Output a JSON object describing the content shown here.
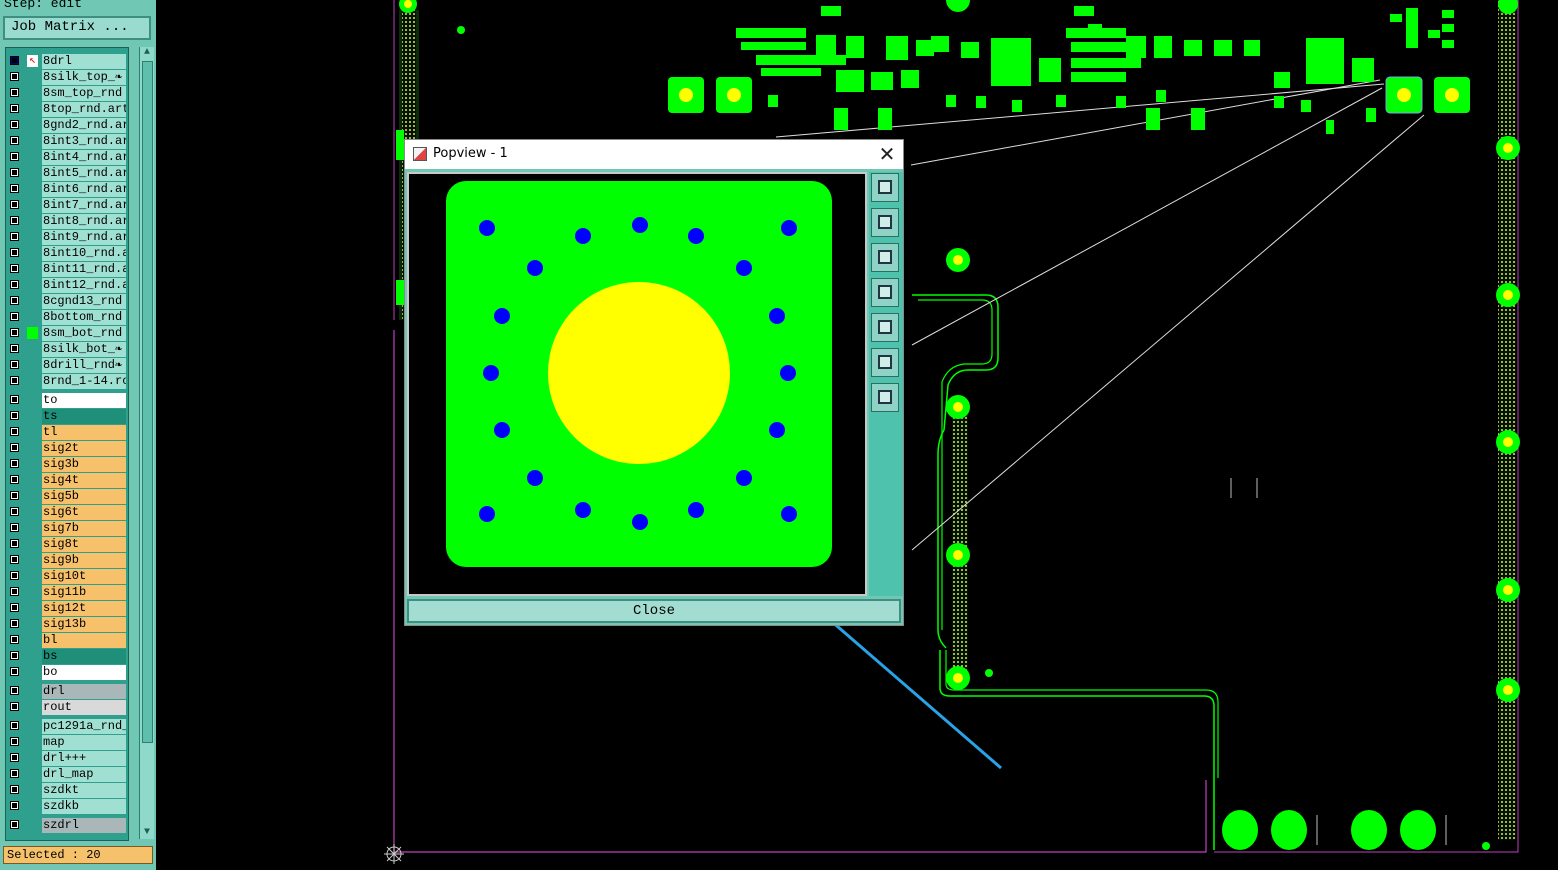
{
  "left_panel": {
    "step_label": "Step: edit",
    "job_matrix_label": "Job Matrix ...",
    "layers": [
      {
        "name": "8drl",
        "color": "#9fe0d2",
        "marker": "active"
      },
      {
        "name": "8silk_top_❧",
        "color": "#9fe0d2"
      },
      {
        "name": "8sm_top_rnd",
        "color": "#9fe0d2"
      },
      {
        "name": "8top_rnd.art",
        "color": "#9fe0d2"
      },
      {
        "name": "8gnd2_rnd.ar",
        "color": "#9fe0d2"
      },
      {
        "name": "8int3_rnd.ar",
        "color": "#9fe0d2"
      },
      {
        "name": "8int4_rnd.ar",
        "color": "#9fe0d2"
      },
      {
        "name": "8int5_rnd.ar",
        "color": "#9fe0d2"
      },
      {
        "name": "8int6_rnd.ar",
        "color": "#9fe0d2"
      },
      {
        "name": "8int7_rnd.ar",
        "color": "#9fe0d2"
      },
      {
        "name": "8int8_rnd.ar",
        "color": "#9fe0d2"
      },
      {
        "name": "8int9_rnd.ar",
        "color": "#9fe0d2"
      },
      {
        "name": "8int10_rnd.a",
        "color": "#9fe0d2"
      },
      {
        "name": "8int11_rnd.a",
        "color": "#9fe0d2"
      },
      {
        "name": "8int12_rnd.a",
        "color": "#9fe0d2"
      },
      {
        "name": "8cgnd13_rnd",
        "color": "#9fe0d2"
      },
      {
        "name": "8bottom_rnd",
        "color": "#9fe0d2"
      },
      {
        "name": "8sm_bot_rnd",
        "color": "#9fe0d2",
        "marker": "green"
      },
      {
        "name": "8silk_bot_❧",
        "color": "#9fe0d2"
      },
      {
        "name": "8drill_rnd❧",
        "color": "#9fe0d2"
      },
      {
        "name": "8rnd_1-14.ro",
        "color": "#9fe0d2"
      },
      {
        "name": "to",
        "color": "#ffffff",
        "gap": true
      },
      {
        "name": "ts",
        "color": "#1f8f7a"
      },
      {
        "name": "tl",
        "color": "#f7c06a"
      },
      {
        "name": "sig2t",
        "color": "#f7c06a"
      },
      {
        "name": "sig3b",
        "color": "#f7c06a"
      },
      {
        "name": "sig4t",
        "color": "#f7c06a"
      },
      {
        "name": "sig5b",
        "color": "#f7c06a"
      },
      {
        "name": "sig6t",
        "color": "#f7c06a"
      },
      {
        "name": "sig7b",
        "color": "#f7c06a"
      },
      {
        "name": "sig8t",
        "color": "#f7c06a"
      },
      {
        "name": "sig9b",
        "color": "#f7c06a"
      },
      {
        "name": "sig10t",
        "color": "#f7c06a"
      },
      {
        "name": "sig11b",
        "color": "#f7c06a"
      },
      {
        "name": "sig12t",
        "color": "#f7c06a"
      },
      {
        "name": "sig13b",
        "color": "#f7c06a"
      },
      {
        "name": "bl",
        "color": "#f7c06a"
      },
      {
        "name": "bs",
        "color": "#1f8f7a"
      },
      {
        "name": "bo",
        "color": "#ffffff"
      },
      {
        "name": "drl",
        "color": "#a9b7b8",
        "gap": true
      },
      {
        "name": "rout",
        "color": "#d9d9d9"
      },
      {
        "name": "pc1291a_rnd_",
        "color": "#9fe0d2",
        "gap": true
      },
      {
        "name": "map",
        "color": "#9fe0d2"
      },
      {
        "name": "drl+++",
        "color": "#9fe0d2"
      },
      {
        "name": "drl_map",
        "color": "#9fe0d2"
      },
      {
        "name": "szdkt",
        "color": "#9fe0d2"
      },
      {
        "name": "szdkb",
        "color": "#9fe0d2"
      },
      {
        "name": "szdrl",
        "color": "#a9b7b8",
        "gap": true
      }
    ],
    "selected_status": "Selected : 20"
  },
  "popview": {
    "title": "Popview - 1",
    "close_label": "Close",
    "toolbar_icons": [
      "zoom-window-icon",
      "pan-up-icon",
      "pan-down-icon",
      "pan-left-icon",
      "pan-right-icon",
      "zoom-fit-icon",
      "zoom-home-icon"
    ]
  },
  "colors": {
    "panel_bg": "#6fc7b4",
    "copper": "#00ff00",
    "pad_center": "#ffff00",
    "via_blue": "#0000ff",
    "annotation_arrow": "#29a3e6"
  }
}
